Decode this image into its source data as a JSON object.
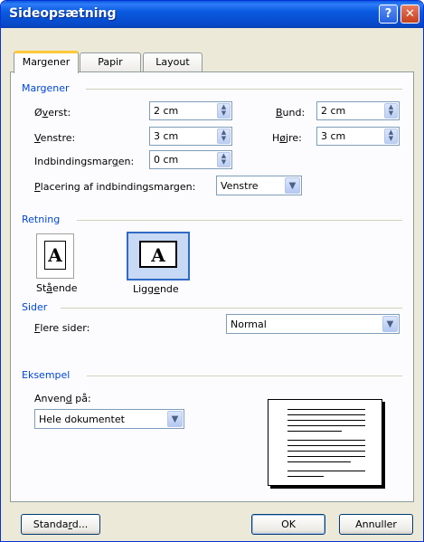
{
  "window": {
    "title": "Sideopsætning",
    "help_glyph": "?",
    "close_glyph": "✕"
  },
  "tabs": [
    {
      "label": "Margener",
      "active": true
    },
    {
      "label": "Papir",
      "active": false
    },
    {
      "label": "Layout",
      "active": false
    }
  ],
  "margins": {
    "group_title": "Margener",
    "top": {
      "pre": "Ø",
      "ul": "v",
      "post": "erst:",
      "value": "2 cm"
    },
    "bottom": {
      "pre": "",
      "ul": "B",
      "post": "und:",
      "value": "2 cm"
    },
    "left": {
      "pre": "",
      "ul": "V",
      "post": "enstre:",
      "value": "3 cm"
    },
    "right": {
      "pre": "H",
      "ul": "ø",
      "post": "jre:",
      "value": "3 cm"
    },
    "gutter": {
      "pre": "Indbindingsmar",
      "ul": "g",
      "post": "en:",
      "value": "0 cm"
    },
    "gutter_pos": {
      "pre": "",
      "ul": "P",
      "post": "lacering af indbindingsmargen:",
      "value": "Venstre"
    }
  },
  "orientation": {
    "group_title": "Retning",
    "page_glyph": "A",
    "portrait": {
      "pre": "St",
      "ul": "å",
      "post": "ende"
    },
    "landscape": {
      "pre": "Ligg",
      "ul": "e",
      "post": "nde"
    }
  },
  "pages": {
    "group_title": "Sider",
    "multiple": {
      "pre": "",
      "ul": "F",
      "post": "lere sider:",
      "value": "Normal"
    }
  },
  "preview": {
    "group_title": "Eksempel",
    "apply_to": {
      "pre": "Anven",
      "ul": "d",
      "post": " på:",
      "value": "Hele dokumentet"
    }
  },
  "buttons": {
    "default": {
      "pre": "Standa",
      "ul": "r",
      "post": "d..."
    },
    "ok": "OK",
    "cancel": "Annuller"
  },
  "icons": {
    "spin": "spin-up-down-icon",
    "dropdown": "chevron-down-icon"
  },
  "colors": {
    "title_blue": "#0a5ae0",
    "group_title": "#0046d5",
    "selection_border": "#316ac5",
    "tab_highlight": "#ffc83c"
  }
}
